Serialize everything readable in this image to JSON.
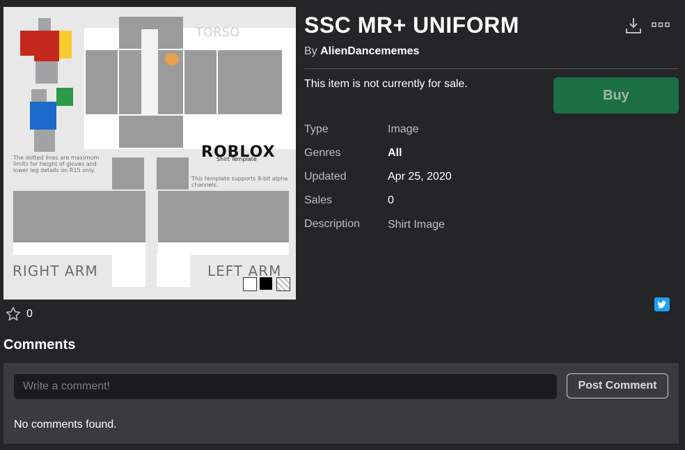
{
  "item": {
    "title": "SSC MR+ UNIFORM",
    "by_prefix": "By",
    "creator": "AlienDancememes",
    "sale_message": "This item is not currently for sale.",
    "buy_label": "Buy"
  },
  "details": {
    "type_label": "Type",
    "type_value": "Image",
    "genres_label": "Genres",
    "genres_value": "All",
    "updated_label": "Updated",
    "updated_value": "Apr 25, 2020",
    "sales_label": "Sales",
    "sales_value": "0",
    "description_label": "Description",
    "description_value": "Shirt Image"
  },
  "template_image": {
    "torso_label": "TORSO",
    "brand": "ROBLOX",
    "subtitle": "Shirt Template",
    "note_left": "The dotted lines are maximum limits for height of gloves and lower leg details on R15 only.",
    "note_right": "This template supports 8-bit alpha channels.",
    "right_arm": "RIGHT ARM",
    "left_arm": "LEFT ARM"
  },
  "favorites": {
    "count": "0"
  },
  "comments": {
    "title": "Comments",
    "placeholder": "Write a comment!",
    "post_label": "Post Comment",
    "empty_message": "No comments found."
  },
  "colors": {
    "background": "#232527",
    "panel": "#393b3d",
    "buy_button": "#1c6f43",
    "twitter": "#1da1f2"
  },
  "icons": [
    "download-icon",
    "more-options-icon",
    "star-icon",
    "twitter-icon"
  ]
}
